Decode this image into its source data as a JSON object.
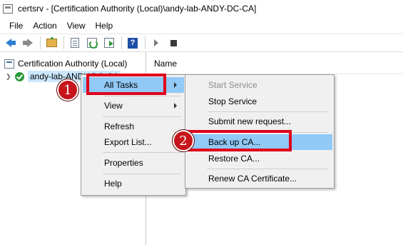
{
  "window": {
    "title": "certsrv - [Certification Authority (Local)\\andy-lab-ANDY-DC-CA]"
  },
  "menubar": [
    "File",
    "Action",
    "View",
    "Help"
  ],
  "toolbar": {
    "icons": [
      "back-icon",
      "forward-icon",
      "up-folder-icon",
      "properties-icon",
      "refresh-icon",
      "export-list-icon",
      "help-icon",
      "start-service-icon",
      "stop-service-icon"
    ]
  },
  "tree": {
    "root": "Certification Authority (Local)",
    "child": "andy-lab-ANDY-DC-CA"
  },
  "list": {
    "column_name": "Name"
  },
  "context_menu": {
    "items": [
      "All Tasks",
      "View",
      "Refresh",
      "Export List...",
      "Properties",
      "Help"
    ]
  },
  "submenu": {
    "items": [
      "Start Service",
      "Stop Service",
      "Submit new request...",
      "Back up CA...",
      "Restore CA...",
      "Renew CA Certificate..."
    ]
  },
  "annotations": {
    "step1": "1",
    "step2": "2"
  },
  "colors": {
    "highlight": "#91c9f7",
    "annotation_red": "#e0001a",
    "badge_red": "#c6151b",
    "tree_selection": "#cce8ff"
  }
}
